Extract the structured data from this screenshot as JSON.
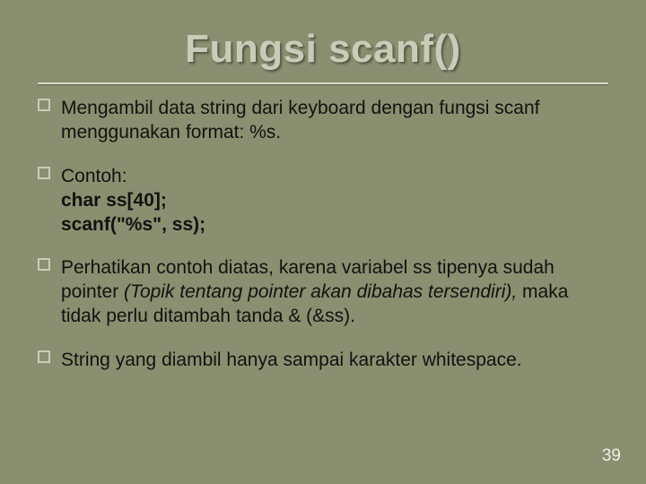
{
  "title": "Fungsi scanf()",
  "paras": {
    "p1": {
      "text": "Mengambil data string dari keyboard dengan fungsi scanf menggunakan format: %s."
    },
    "p2": {
      "lead": "Contoh:",
      "code1": "char ss[40];",
      "code2": "scanf(\"%s\", ss);"
    },
    "p3": {
      "a": "Perhatikan contoh diatas, karena variabel ss tipenya sudah pointer ",
      "b": "(Topik tentang pointer akan dibahas tersendiri),",
      "c": " maka tidak perlu ditambah tanda & (&ss)."
    },
    "p4": {
      "text": "String yang diambil hanya sampai karakter whitespace."
    }
  },
  "page_number": "39"
}
